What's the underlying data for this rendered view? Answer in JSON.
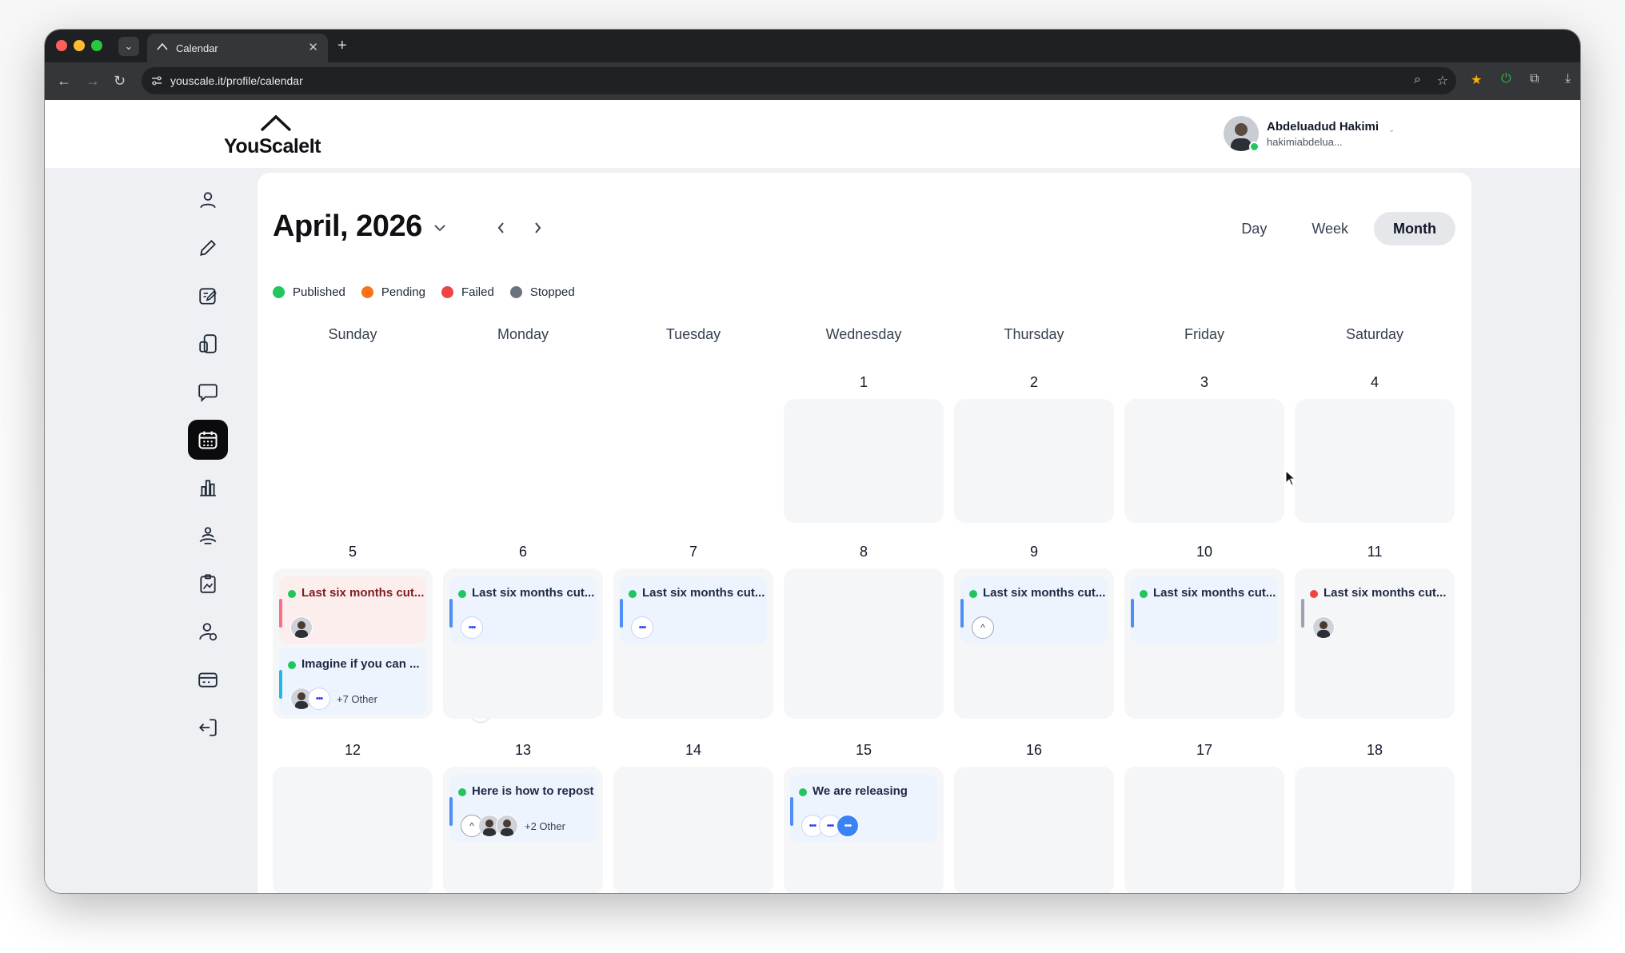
{
  "browser": {
    "tab_title": "Calendar",
    "url": "youscale.it/profile/calendar"
  },
  "app": {
    "logo_text": "YouScaleIt",
    "user": {
      "name": "Abdeluadud Hakimi",
      "email": "hakimiabdelua..."
    },
    "sidebar_icons": [
      "user-icon",
      "pencil-icon",
      "edit-icon",
      "post-icon",
      "chat-icon",
      "calendar-icon",
      "analytics-icon",
      "team-icon",
      "clipboard-icon",
      "account-icon",
      "billing-icon",
      "logout-icon"
    ],
    "active_sidebar": "calendar-icon"
  },
  "calendar": {
    "title": "April, 2026",
    "views": [
      "Day",
      "Week",
      "Month"
    ],
    "active_view": "Month",
    "legend": [
      {
        "label": "Published",
        "color": "#22c55e"
      },
      {
        "label": "Pending",
        "color": "#f97316"
      },
      {
        "label": "Failed",
        "color": "#ef4444"
      },
      {
        "label": "Stopped",
        "color": "#6b7280"
      }
    ],
    "weekdays": [
      "Sunday",
      "Monday",
      "Tuesday",
      "Wednesday",
      "Thursday",
      "Friday",
      "Saturday"
    ],
    "weeks": [
      {
        "days": [
          "",
          "",
          "",
          "1",
          "2",
          "3",
          "4"
        ]
      },
      {
        "days": [
          "5",
          "6",
          "7",
          "8",
          "9",
          "10",
          "11"
        ]
      },
      {
        "days": [
          "12",
          "13",
          "14",
          "15",
          "16",
          "17",
          "18"
        ]
      }
    ],
    "events": [
      {
        "week": 1,
        "col": 0,
        "slot": 0,
        "title": "Last six months cut...",
        "dot": "#22c55e",
        "bar": "#f87185",
        "style": "failed",
        "chips": [
          "person"
        ],
        "more": ""
      },
      {
        "week": 1,
        "col": 0,
        "slot": 1,
        "title": "Imagine if you can ...",
        "dot": "#22c55e",
        "bar": "#22b8e8",
        "style": "normal",
        "chips": [
          "person",
          "dots",
          "logo"
        ],
        "more": "+7 Other"
      },
      {
        "week": 1,
        "col": 1,
        "slot": 0,
        "title": "Last six months cut...",
        "dot": "#22c55e",
        "bar": "#4f8ef7",
        "style": "normal",
        "chips": [
          "dots"
        ],
        "more": ""
      },
      {
        "week": 1,
        "col": 2,
        "slot": 0,
        "title": "Last six months cut...",
        "dot": "#22c55e",
        "bar": "#4f8ef7",
        "style": "normal",
        "chips": [
          "dots"
        ],
        "more": ""
      },
      {
        "week": 1,
        "col": 4,
        "slot": 0,
        "title": "Last six months cut...",
        "dot": "#22c55e",
        "bar": "#4f8ef7",
        "style": "normal",
        "chips": [
          "caret"
        ],
        "more": ""
      },
      {
        "week": 1,
        "col": 5,
        "slot": 0,
        "title": "Last six months cut...",
        "dot": "#22c55e",
        "bar": "#4f8ef7",
        "style": "normal",
        "chips": [
          "logo"
        ],
        "more": ""
      },
      {
        "week": 1,
        "col": 6,
        "slot": 0,
        "title": "Last six months cut...",
        "dot": "#ef4444",
        "bar": "#9ca3af",
        "style": "plain",
        "chips": [
          "person"
        ],
        "more": ""
      },
      {
        "week": 2,
        "col": 1,
        "slot": 0,
        "title": "Here is how to repost",
        "dot": "#22c55e",
        "bar": "#4f8ef7",
        "style": "normal",
        "chips": [
          "caret",
          "person",
          "person"
        ],
        "more": "+2 Other"
      },
      {
        "week": 2,
        "col": 3,
        "slot": 0,
        "title": "We are releasing",
        "dot": "#22c55e",
        "bar": "#4f8ef7",
        "style": "normal",
        "chips": [
          "dots",
          "dots",
          "blue"
        ],
        "more": ""
      }
    ]
  }
}
